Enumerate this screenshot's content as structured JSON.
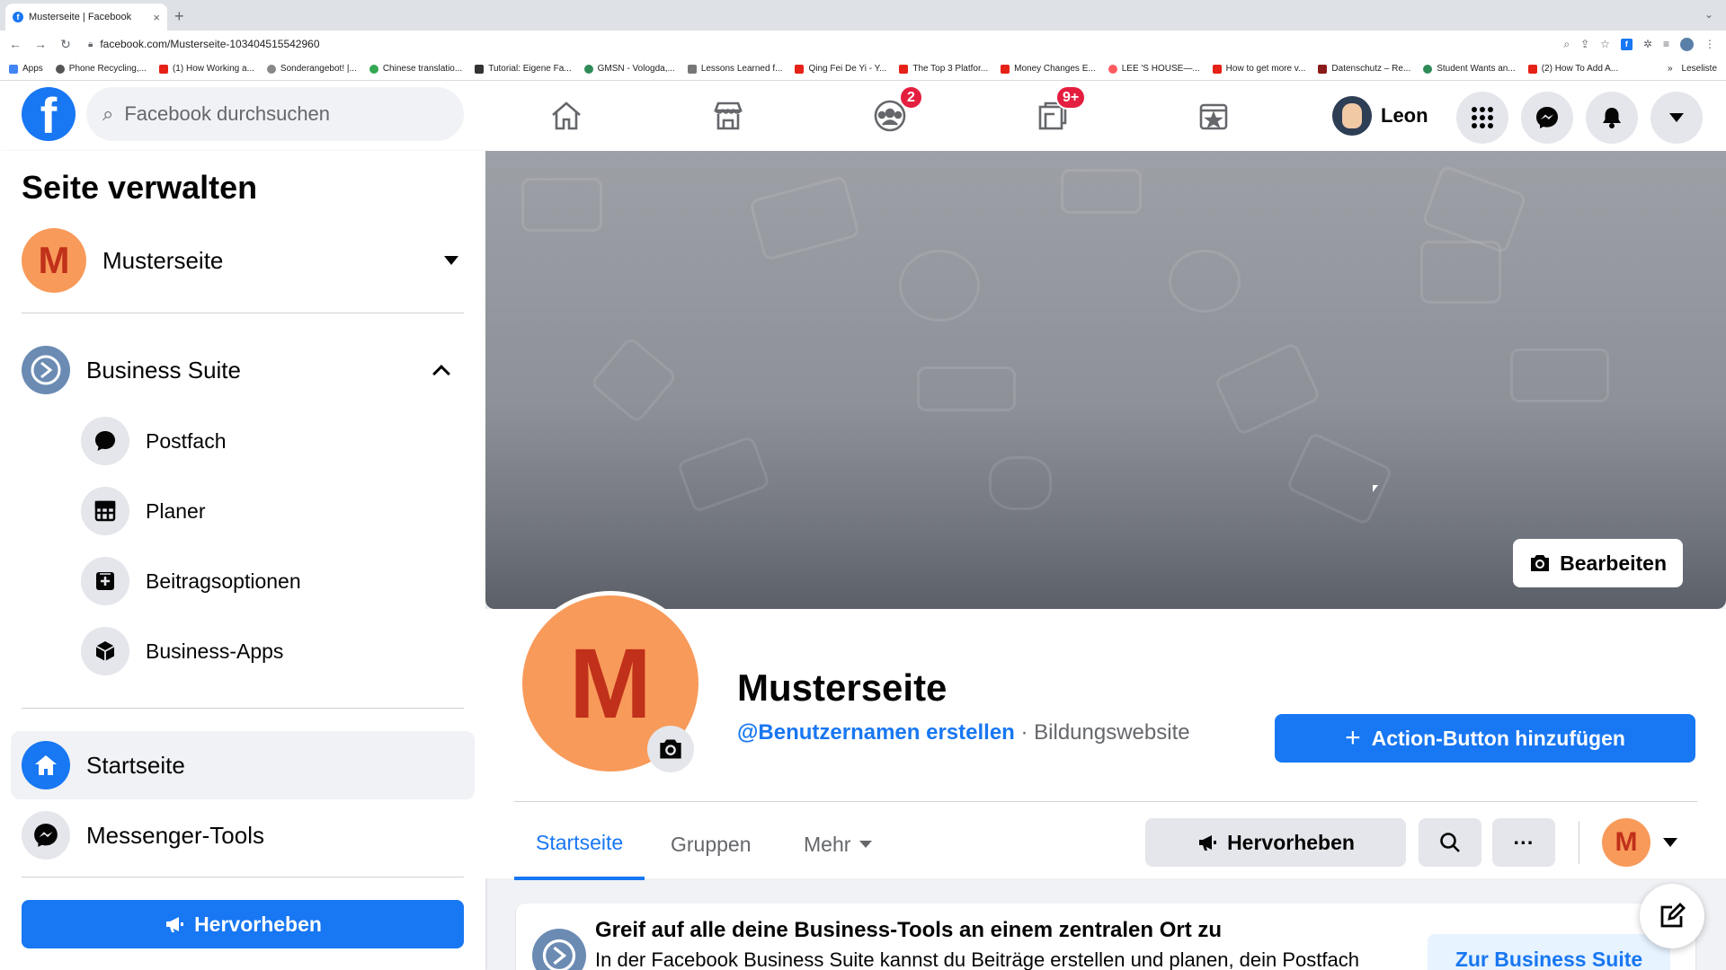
{
  "browser": {
    "tab_title": "Musterseite | Facebook",
    "tab_close": "×",
    "new_tab": "+",
    "url": "facebook.com/Musterseite-103404515542960",
    "bookmarks": [
      "Apps",
      "Phone Recycling,...",
      "(1) How Working a...",
      "Sonderangebot! |...",
      "Chinese translatio...",
      "Tutorial: Eigene Fa...",
      "GMSN - Vologda,...",
      "Lessons Learned f...",
      "Qing Fei De Yi - Y...",
      "The Top 3 Platfor...",
      "Money Changes E...",
      "LEE 'S HOUSE—...",
      "How to get more v...",
      "Datenschutz – Re...",
      "Student Wants an...",
      "(2) How To Add A..."
    ],
    "bookmarks_more": "»",
    "reading_list": "Leseliste"
  },
  "nav": {
    "search_placeholder": "Facebook durchsuchen",
    "groups_badge": "2",
    "pages_badge": "9+",
    "user_name": "Leon"
  },
  "sidebar": {
    "title": "Seite verwalten",
    "page_name": "Musterseite",
    "page_initial": "M",
    "business_suite": "Business Suite",
    "sub_items": [
      "Postfach",
      "Planer",
      "Beitragsoptionen",
      "Business-Apps"
    ],
    "home": "Startseite",
    "messenger_tools": "Messenger-Tools",
    "promote": "Hervorheben"
  },
  "cover": {
    "edit_label": "Bearbeiten"
  },
  "profile": {
    "initial": "M",
    "name": "Musterseite",
    "username_link": "@Benutzernamen erstellen",
    "separator": " · ",
    "category": "Bildungswebsite",
    "action_button": "Action-Button hinzufügen",
    "action_plus": "+",
    "tabs": [
      "Startseite",
      "Gruppen",
      "Mehr"
    ],
    "promote": "Hervorheben",
    "more_dots": "···"
  },
  "business_card": {
    "title": "Greif auf alle deine Business-Tools an einem zentralen Ort zu",
    "text": "In der Facebook Business Suite kannst du Beiträge erstellen und planen, dein Postfach",
    "button": "Zur Business Suite"
  },
  "colors": {
    "brand": "#1877f2",
    "badge": "#e41e3f",
    "avatar_bg": "#f89a5a",
    "avatar_fg": "#c0301a"
  }
}
